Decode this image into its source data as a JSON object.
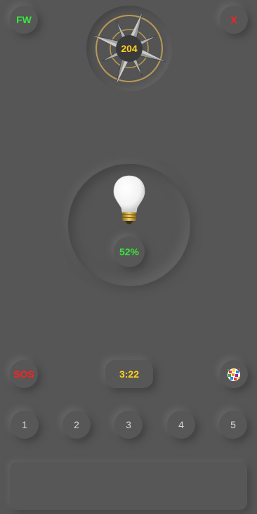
{
  "header": {
    "fw_label": "FW",
    "close_label": "X",
    "compass_value": "204"
  },
  "light": {
    "brightness_label": "52%",
    "brightness_percent": 52
  },
  "controls": {
    "sos_label": "SOS",
    "timer_label": "3:22"
  },
  "presets": [
    "1",
    "2",
    "3",
    "4",
    "5"
  ],
  "icons": {
    "compass": "compass-rose-icon",
    "bulb": "light-bulb-icon",
    "color": "color-palette-icon"
  },
  "colors": {
    "background": "#565656",
    "green": "#39e63d",
    "red": "#ff2020",
    "yellow": "#ffd21a",
    "preset_text": "#d8d8d8"
  }
}
